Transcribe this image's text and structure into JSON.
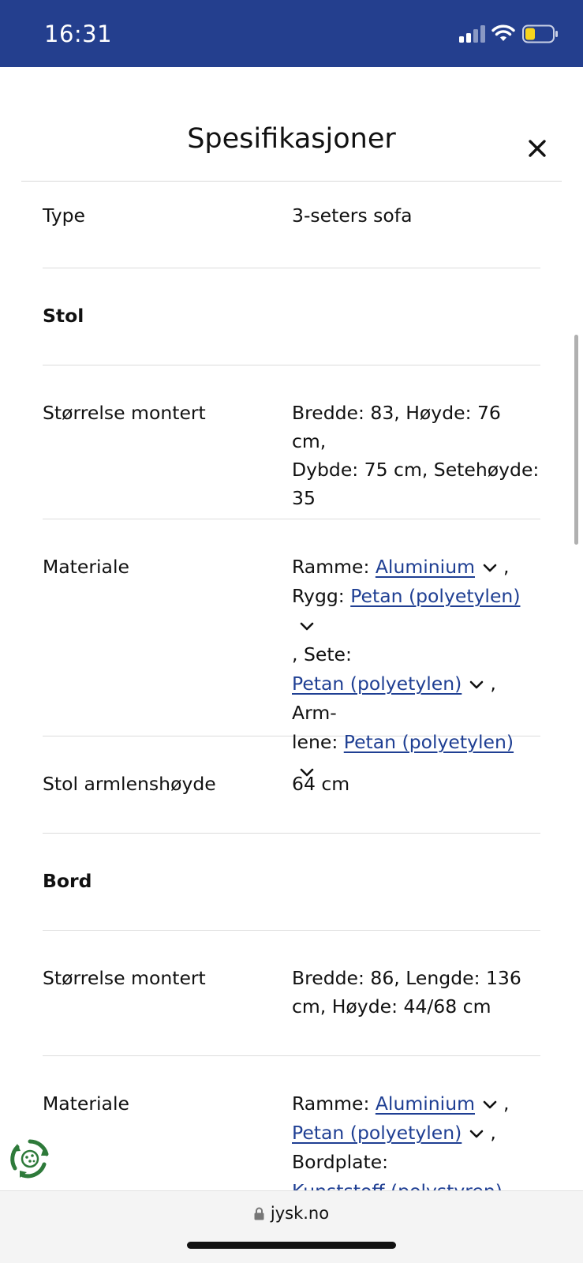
{
  "status_bar": {
    "time": "16:31",
    "battery_color": "#f7d51d",
    "bg_color": "#243f8e"
  },
  "modal": {
    "title": "Spesifikasjoner",
    "close_icon": "close-icon"
  },
  "rows": {
    "type": {
      "label": "Type",
      "value": "3-seters sofa"
    },
    "stol_heading": "Stol",
    "stol_size": {
      "label": "Størrelse montert",
      "line1": "Bredde: 83, Høyde: 76 cm,",
      "line2": "Dybde: 75 cm, Setehøyde:",
      "line3": "35"
    },
    "stol_material": {
      "label": "Materiale",
      "ramme_prefix": "Ramme:",
      "ramme_link": "Aluminium",
      "rygg_prefix": "Rygg:",
      "rygg_link": "Petan (polyetylen)",
      "comma": ",",
      "sete_prefix": ", Sete:",
      "sete_link": "Petan (polyetylen)",
      "arm_prefix": ", Arm-",
      "arm_prefix2": "lene:",
      "arm_link": "Petan (polyetylen)"
    },
    "stol_arm": {
      "label": "Stol armlenshøyde",
      "value": "64 cm"
    },
    "bord_heading": "Bord",
    "bord_size": {
      "label": "Størrelse montert",
      "line1": "Bredde: 86, Lengde: 136",
      "line2": "cm, Høyde: 44/68 cm"
    },
    "bord_material": {
      "label": "Materiale",
      "ramme_prefix": "Ramme:",
      "ramme_link": "Aluminium",
      "second_link": "Petan (polyetylen)",
      "bordplate_prefix": "Bordplate:",
      "partial_link": "Kunststoff (polystyren)"
    }
  },
  "browser": {
    "url": "jysk.no"
  },
  "colors": {
    "link": "#1f3f93",
    "divider": "#dcdcdc"
  }
}
